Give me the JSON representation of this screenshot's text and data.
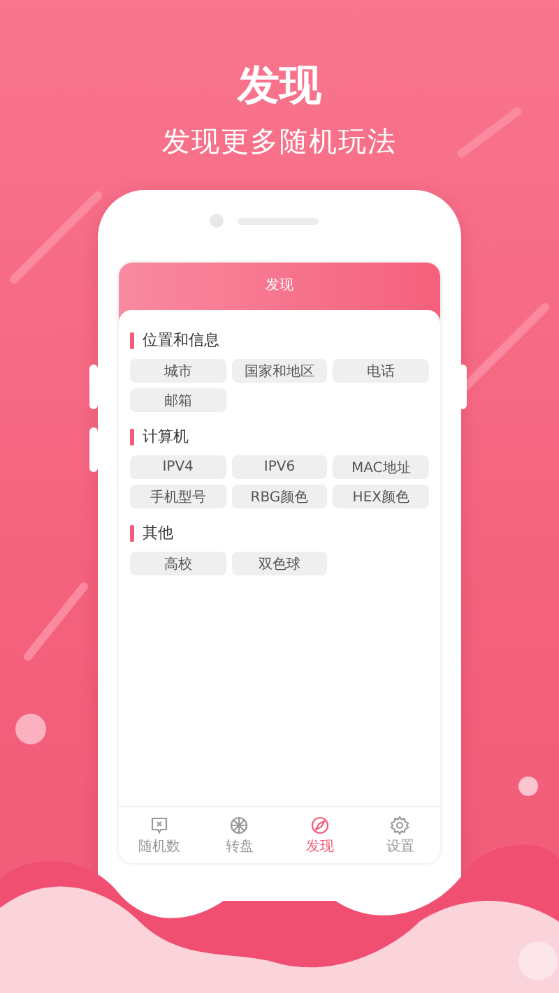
{
  "headline": "发现",
  "subtitle": "发现更多随机玩法",
  "app": {
    "title": "发现",
    "sections": [
      {
        "title": "位置和信息",
        "items": [
          "城市",
          "国家和地区",
          "电话",
          "邮箱"
        ]
      },
      {
        "title": "计算机",
        "items": [
          "IPV4",
          "IPV6",
          "MAC地址",
          "手机型号",
          "RBG颜色",
          "HEX颜色"
        ]
      },
      {
        "title": "其他",
        "items": [
          "高校",
          "双色球"
        ]
      }
    ],
    "tabs": [
      {
        "label": "随机数",
        "kind": "dice",
        "selected": false
      },
      {
        "label": "转盘",
        "kind": "wheel",
        "selected": false
      },
      {
        "label": "发现",
        "kind": "compass",
        "selected": true
      },
      {
        "label": "设置",
        "kind": "gear",
        "selected": false
      }
    ]
  }
}
